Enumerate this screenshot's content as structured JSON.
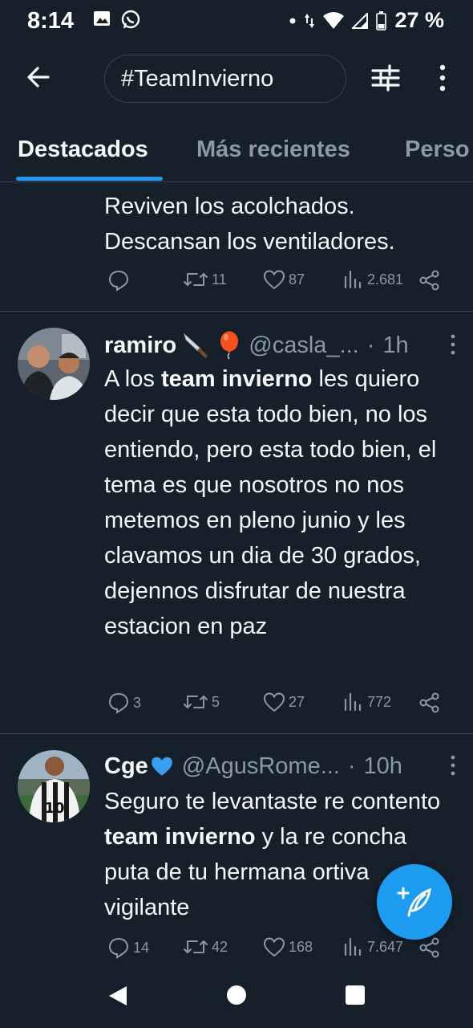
{
  "status_bar": {
    "time": "8:14",
    "battery": "27 %"
  },
  "search": {
    "query": "#TeamInvierno"
  },
  "tabs": [
    {
      "label": "Destacados",
      "active": true
    },
    {
      "label": "Más recientes",
      "active": false
    },
    {
      "label": "Perso",
      "active": false
    }
  ],
  "tweets": [
    {
      "body_lines": [
        "Reviven los acolchados.",
        "Descansan los ventiladores."
      ],
      "replies": "",
      "retweets": "11",
      "likes": "87",
      "views": "2.681"
    },
    {
      "name": "ramiro",
      "emojis": [
        "knife",
        "balloon"
      ],
      "handle": "@casla_...",
      "dot": "·",
      "time": "1h",
      "body": {
        "pre": "A los ",
        "bold": "team invierno",
        "post": " les quiero decir que esta todo bien, no los entiendo, pero esta todo bien, el tema es que nosotros no nos metemos en pleno junio y les clavamos un dia de 30 grados, dejennos disfrutar de nuestra estacion en paz"
      },
      "replies": "3",
      "retweets": "5",
      "likes": "27",
      "views": "772"
    },
    {
      "name": "Cge",
      "emojis": [
        "blue-heart"
      ],
      "handle": "@AgusRome...",
      "dot": "·",
      "time": "10h",
      "body": {
        "pre": "Seguro te levantaste re contento ",
        "bold": "team invierno",
        "post": " y la re concha puta de tu hermana ortiva vigilante"
      },
      "replies": "14",
      "retweets": "42",
      "likes": "168",
      "views": "7.647"
    }
  ],
  "colors": {
    "background": "#15202b",
    "accent": "#1d9bf0",
    "muted": "#8b98a5",
    "divider": "#38444d"
  },
  "icons": [
    "back-arrow-icon",
    "filter-sliders-icon",
    "more-vertical-icon",
    "reply-icon",
    "retweet-icon",
    "like-icon",
    "views-icon",
    "share-icon",
    "compose-icon"
  ]
}
